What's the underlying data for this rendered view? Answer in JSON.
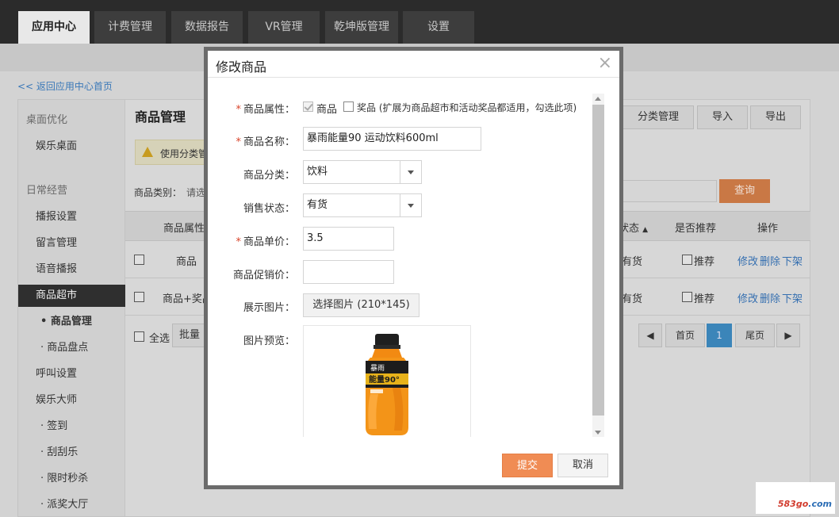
{
  "nav": {
    "tabs": [
      {
        "label": "应用中心",
        "active": true
      },
      {
        "label": "计费管理",
        "active": false
      },
      {
        "label": "数据报告",
        "active": false
      },
      {
        "label": "VR管理",
        "active": false
      },
      {
        "label": "乾坤版管理",
        "active": false
      },
      {
        "label": "设置",
        "active": false
      }
    ]
  },
  "breadcrumb": {
    "back_link": "<< 返回应用中心首页"
  },
  "sidebar": {
    "items": [
      {
        "label": "桌面优化"
      },
      {
        "label": "娱乐桌面"
      },
      {
        "label": "日常经营"
      },
      {
        "label": "播报设置"
      },
      {
        "label": "留言管理"
      },
      {
        "label": "语音播报"
      },
      {
        "label": "商品超市"
      },
      {
        "label": "• 商品管理"
      },
      {
        "label": "· 商品盘点"
      },
      {
        "label": "呼叫设置"
      },
      {
        "label": "娱乐大师"
      },
      {
        "label": "· 签到"
      },
      {
        "label": "· 刮刮乐"
      },
      {
        "label": "· 限时秒杀"
      },
      {
        "label": "· 派奖大厅"
      }
    ]
  },
  "content": {
    "title": "商品管理",
    "toolbar": {
      "category_btn": "分类管理",
      "import_btn": "导入",
      "export_btn": "导出"
    },
    "warning": "使用分类管",
    "filter": {
      "label": "商品类别：",
      "placeholder": "请选",
      "query_btn": "查询"
    },
    "table": {
      "headers": {
        "attr": "商品属性",
        "status": "状态",
        "recommend": "是否推荐",
        "ops": "操作"
      },
      "rows": [
        {
          "attr": "商品",
          "status": "有货",
          "recommend": "推荐",
          "edit": "修改",
          "delete": "删除",
          "offline": "下架"
        },
        {
          "attr": "商品+奖品",
          "status": "有货",
          "recommend": "推荐",
          "edit": "修改",
          "delete": "删除",
          "offline": "下架"
        }
      ]
    },
    "bulk": {
      "select_all": "全选",
      "batch_btn": "批量"
    },
    "pager": {
      "first": "首页",
      "current": "1",
      "last": "尾页",
      "prev_icon": "chevron-left",
      "next_icon": "chevron-right"
    }
  },
  "modal": {
    "title": "修改商品",
    "close_icon": "×",
    "fields": {
      "attr": {
        "label": "商品属性：",
        "opt_goods": "商品",
        "opt_prize": "奖品 (扩展为商品超市和活动奖品都适用，勾选此项)"
      },
      "name": {
        "label": "商品名称：",
        "value": "暴雨能量90 运动饮料600ml"
      },
      "category": {
        "label": "商品分类：",
        "value": "饮料"
      },
      "sale_status": {
        "label": "销售状态：",
        "value": "有货"
      },
      "price": {
        "label": "商品单价：",
        "value": "3.5"
      },
      "promo_price": {
        "label": "商品促销价：",
        "value": ""
      },
      "image": {
        "label": "展示图片：",
        "button": "选择图片 (210*145)"
      },
      "preview": {
        "label": "图片预览：",
        "bottle_brand": "暴雨",
        "bottle_text": "能量90°"
      }
    },
    "footer": {
      "submit": "提交",
      "cancel": "取消"
    }
  },
  "watermark": {
    "prefix": "583go",
    "suffix": ".com"
  },
  "colors": {
    "accent_orange": "#f08c54",
    "topbar": "#2b2b2b",
    "link_blue": "#356fb0"
  }
}
